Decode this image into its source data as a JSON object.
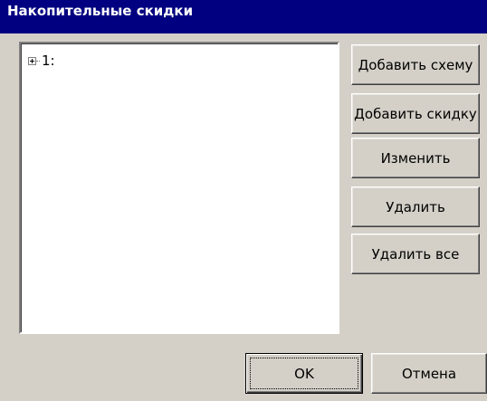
{
  "window": {
    "title": "Накопительные скидки"
  },
  "tree": {
    "nodes": [
      {
        "label": "1:",
        "expanded": false
      }
    ]
  },
  "buttons": {
    "add_scheme": "Добавить схему",
    "add_discount": "Добавить скидку",
    "edit": "Изменить",
    "delete": "Удалить",
    "delete_all": "Удалить все",
    "ok": "OK",
    "cancel": "Отмена"
  },
  "colors": {
    "titlebar": "#000080",
    "face": "#d4d0c8",
    "list_bg": "#ffffff"
  }
}
